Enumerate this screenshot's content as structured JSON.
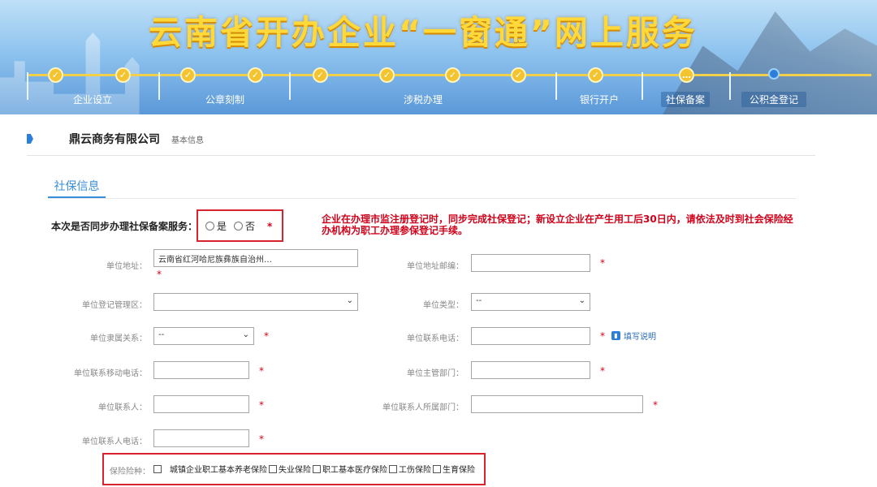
{
  "banner": {
    "title": "云南省开办企业“一窗通”网上服务",
    "steps": [
      "企业设立",
      "公章刻制",
      "涉税办理",
      "银行开户",
      "社保备案",
      "公积金登记"
    ],
    "colors": {
      "gold": "#f4c430",
      "current": "#2b7fd9"
    }
  },
  "company": {
    "name": "鼎云商务有限公司",
    "subtitle": "基本信息"
  },
  "tab": {
    "label": "社保信息"
  },
  "question": {
    "label": "本次是否同步办理社保备案服务：",
    "opt_yes": "是",
    "opt_no": "否",
    "required": "*"
  },
  "notice": "企业在办理市监注册登记时，同步完成社保登记；新设立企业在产生用工后30日内，请依法及时到社会保险经办机构为职工办理参保登记手续。",
  "form": {
    "address": {
      "label": "单位地址：",
      "value": "云南省红河哈尼族彝族自治州…"
    },
    "postcode": {
      "label": "单位地址邮编：",
      "value": ""
    },
    "reg_area": {
      "label": "单位登记管理区：",
      "value": ""
    },
    "unit_type": {
      "label": "单位类型：",
      "value": "--"
    },
    "affiliation": {
      "label": "单位隶属关系：",
      "value": "--"
    },
    "phone": {
      "label": "单位联系电话：",
      "value": ""
    },
    "help_text": "填写说明",
    "mobile": {
      "label": "单位联系移动电话：",
      "value": ""
    },
    "department": {
      "label": "单位主管部门：",
      "value": ""
    },
    "contact": {
      "label": "单位联系人：",
      "value": ""
    },
    "contact_dept": {
      "label": "单位联系人所属部门：",
      "value": ""
    },
    "contact_phone": {
      "label": "单位联系人电话：",
      "value": ""
    },
    "required_mark": "*"
  },
  "insurance": {
    "label": "保险险种：",
    "items": [
      "城镇企业职工基本养老保险",
      "失业保险",
      "职工基本医疗保险",
      "工伤保险",
      "生育保险"
    ]
  }
}
